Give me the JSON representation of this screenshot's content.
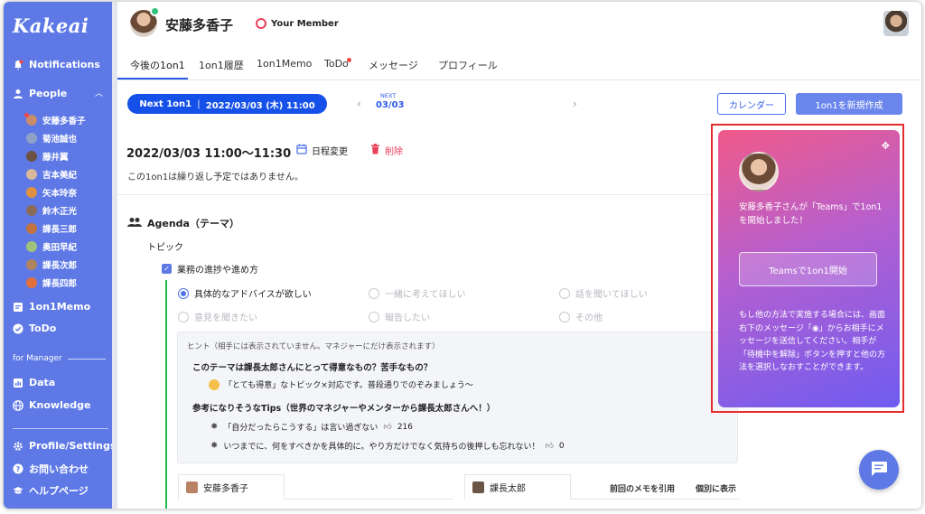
{
  "app": {
    "logo": "Kakeai"
  },
  "sidebar": {
    "notifications": "Notifications",
    "people": "People",
    "members": [
      "安藤多香子",
      "菊池誠也",
      "藤井翼",
      "吉本美紀",
      "矢本玲奈",
      "鈴木正光",
      "課長三郎",
      "奥田早紀",
      "課長次郎",
      "課長四郎"
    ],
    "one_on_one_memo": "1on1Memo",
    "todo": "ToDo",
    "for_manager": "for Manager",
    "data": "Data",
    "knowledge": "Knowledge",
    "profile_settings": "Profile/Settings",
    "contact": "お問い合わせ",
    "help": "ヘルプページ"
  },
  "header": {
    "user_name": "安藤多香子",
    "member_label": "Your Member"
  },
  "tabs": [
    "今後の1on1",
    "1on1履歴",
    "1on1Memo",
    "ToDo",
    "メッセージ",
    "プロフィール"
  ],
  "toolbar": {
    "next_label": "Next 1on1",
    "next_datetime": "2022/03/03 (木) 11:00",
    "next_small": "NEXT",
    "next_date": "03/03",
    "prev_arrow": "‹",
    "next_arrow": "›",
    "calendar_button": "カレンダー",
    "new_button": "1on1を新規作成"
  },
  "meeting": {
    "datetime": "2022/03/03   11:00〜11:30",
    "reschedule": "日程変更",
    "delete": "削除",
    "no_repeat": "この1on1は繰り返し予定ではありません。"
  },
  "agenda": {
    "title": "Agenda（テーマ）",
    "topic_label": "トピック",
    "topic": "業務の進捗や進め方",
    "options": [
      {
        "label": "具体的なアドバイスが欲しい",
        "selected": true
      },
      {
        "label": "一緒に考えてほしい",
        "selected": false
      },
      {
        "label": "話を聞いてほしい",
        "selected": false
      },
      {
        "label": "意見を聞きたい",
        "selected": false
      },
      {
        "label": "報告したい",
        "selected": false
      },
      {
        "label": "その他",
        "selected": false
      }
    ]
  },
  "hint": {
    "title": "ヒント（相手には表示されていません。マネジャーにだけ表示されます）",
    "question": "このテーマは課長太郎さんにとって得意なもの？苦手なもの？",
    "answer": "「とても得意」なトピック×対応です。普段通りでのぞみましょう〜",
    "tips_heading": "参考になりそうなTips（世界のマネジャーやメンターから課長太郎さんへ！）",
    "tips": [
      {
        "text": "「自分だったらこうする」は言い過ぎない",
        "likes": "216"
      },
      {
        "text": "いつまでに、何をすべきかを具体的に。やり方だけでなく気持ちの後押しも忘れない！",
        "likes": "0"
      }
    ]
  },
  "memos": {
    "member_tab": "安藤多香子",
    "manager_tab": "課長太郎",
    "quote_prev": "前回のメモを引用",
    "show_individual": "個別に表示"
  },
  "panel": {
    "message": "安藤多香子さんが「Teams」で1on1を開始しました！",
    "button": "Teamsで1on1開始",
    "note": "もし他の方法で実施する場合には、画面右下のメッセージ「◉」からお相手にメッセージを送信してください。相手が「待機中を解除」ボタンを押すと他の方法を選択しなおすことができます。"
  },
  "colors": {
    "sidebar": "#5e79e6",
    "accent": "#1550e8",
    "highlight": "#e42d2d",
    "progress": "#1dbb4b"
  }
}
